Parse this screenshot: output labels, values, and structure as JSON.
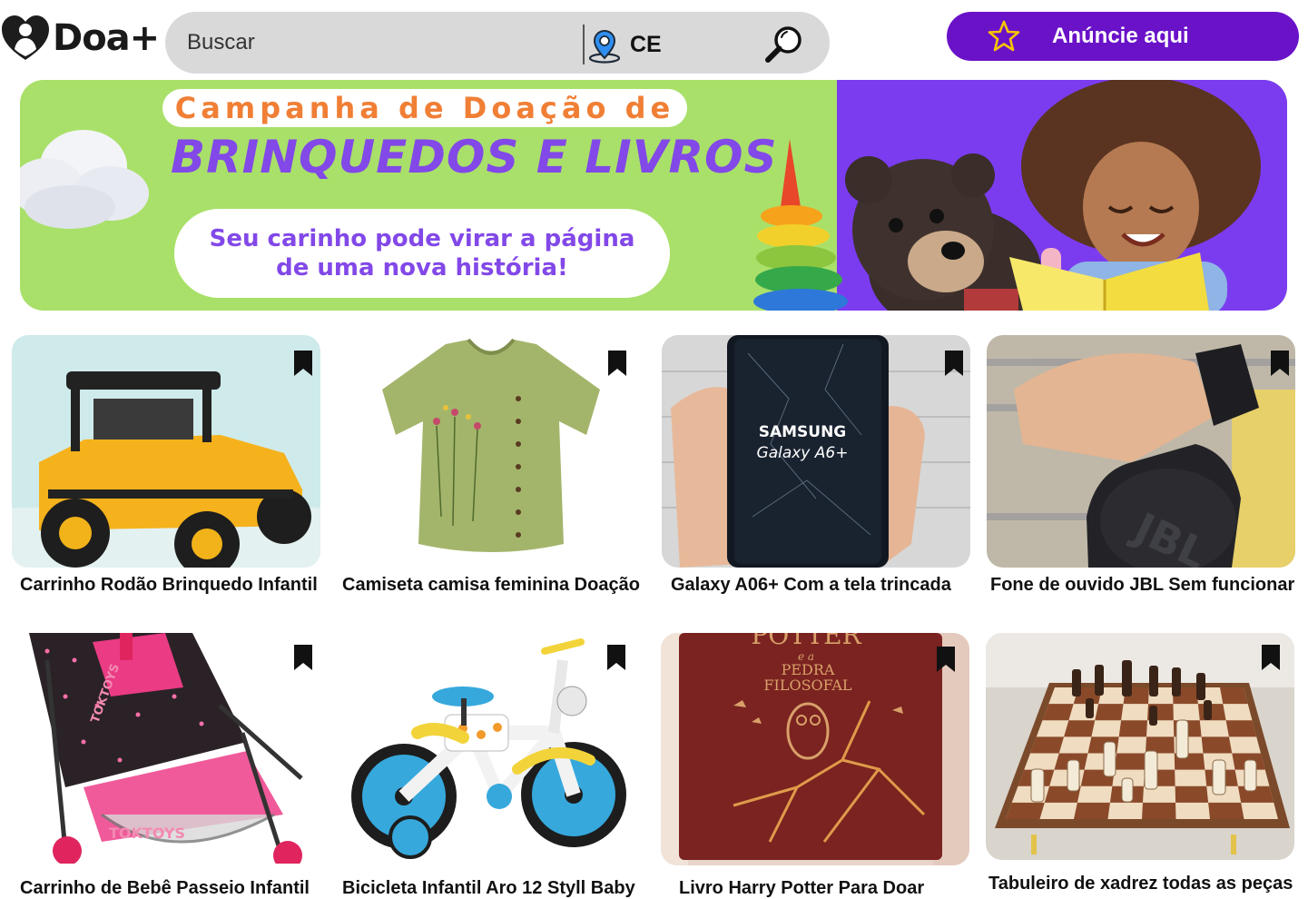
{
  "header": {
    "logo_text": "Doa+",
    "search": {
      "placeholder": "Buscar",
      "location": "CE"
    },
    "ad_button_label": "Anúncie aqui"
  },
  "banner": {
    "line1": "Campanha de Doação de",
    "line2": "BRINQUEDOS E LIVROS",
    "line3": "Seu carinho pode virar a página",
    "line4": "de uma nova história!"
  },
  "colors": {
    "accent_purple": "#6a12c8",
    "banner_green": "#a9e06a",
    "banner_purple": "#7b3cf0",
    "search_gray": "#d9d9d9",
    "star_yellow": "#f6c400"
  },
  "icons": {
    "logo": "heart-person-icon",
    "location": "map-pin-icon",
    "search": "magnifier-icon",
    "ad": "star-icon",
    "save": "bookmark-icon"
  },
  "products": [
    {
      "title": "Carrinho Rodão Brinquedo Infantil",
      "image": "toy-jeep"
    },
    {
      "title": "Camiseta camisa feminina Doação",
      "image": "green-blouse"
    },
    {
      "title": "Galaxy A06+ Com a tela trincada",
      "image": "samsung-phone",
      "image_text": [
        "SAMSUNG",
        "Galaxy A6+"
      ]
    },
    {
      "title": "Fone de ouvido JBL  Sem funcionar",
      "image": "jbl-headphones",
      "image_text": [
        "JBL"
      ]
    },
    {
      "title": "Carrinho de Bebê Passeio Infantil",
      "image": "baby-stroller",
      "image_text": [
        "TOKTOYS",
        "TOKTOYS"
      ]
    },
    {
      "title": "Bicicleta Infantil Aro 12 Styll Baby",
      "image": "kids-bicycle"
    },
    {
      "title": "Livro Harry Potter Para Doar",
      "image": "harry-potter-book",
      "image_text": [
        "POTTER",
        "e a",
        "PEDRA",
        "FILOSOFAL"
      ]
    },
    {
      "title": "Tabuleiro de xadrez todas as peças",
      "image": "chess-board"
    }
  ]
}
